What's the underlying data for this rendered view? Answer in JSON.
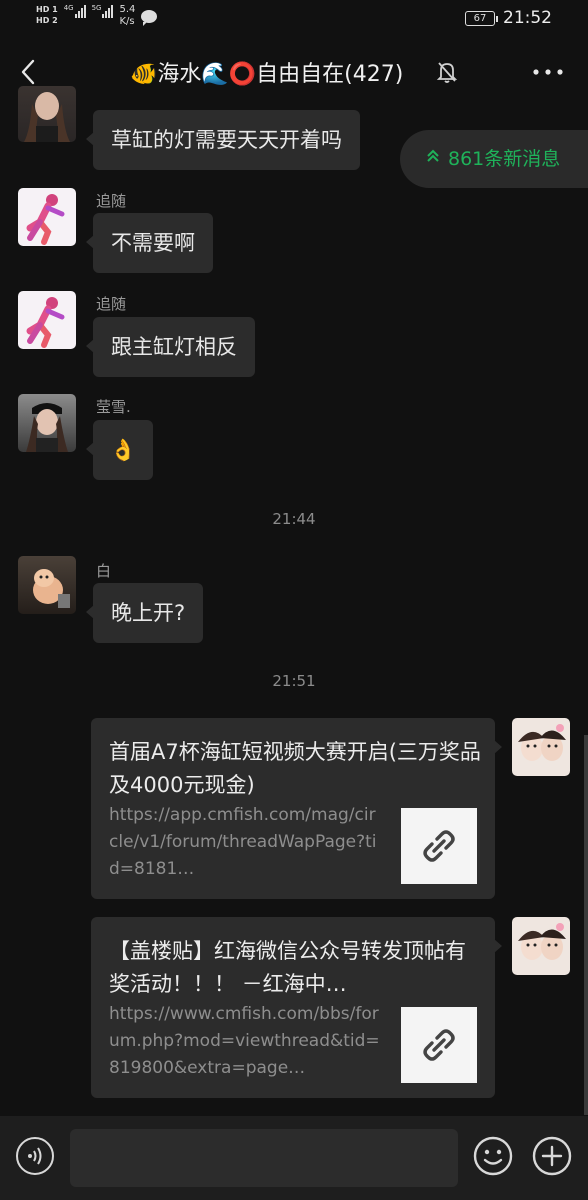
{
  "status_bar": {
    "hd1": "HD 1",
    "hd2": "HD 2",
    "sig1": "4G",
    "sig2": "5G",
    "speed_value": "5.4",
    "speed_unit": "K/s",
    "battery": "67",
    "time": "21:52"
  },
  "header": {
    "title": "🐠海水🌊⭕自由自在(427)"
  },
  "new_messages": "861条新消息",
  "messages": [
    {
      "sender": "",
      "text": "草缸的灯需要天天开着吗"
    },
    {
      "sender": "追随",
      "text": "不需要啊"
    },
    {
      "sender": "追随",
      "text": "跟主缸灯相反"
    },
    {
      "sender": "莹雪.",
      "text": "👌"
    },
    {
      "sender": "白",
      "text": "晚上开?"
    }
  ],
  "timestamps": [
    "21:44",
    "21:51"
  ],
  "cards": [
    {
      "title": "首届A7杯海缸短视频大赛开启(三万奖品及4000元现金)",
      "url": "https://app.cmfish.com/mag/circle/v1/forum/threadWapPage?tid=8181…"
    },
    {
      "title": "【盖楼贴】红海微信公众号转发顶帖有奖活动！！！ －红海中…",
      "url": "https://www.cmfish.com/bbs/forum.php?mod=viewthread&tid=819800&extra=page…"
    }
  ],
  "input": {
    "placeholder": ""
  },
  "colors": {
    "accent": "#1fb25a",
    "bubble": "#2c2c2c",
    "background": "#111111"
  }
}
